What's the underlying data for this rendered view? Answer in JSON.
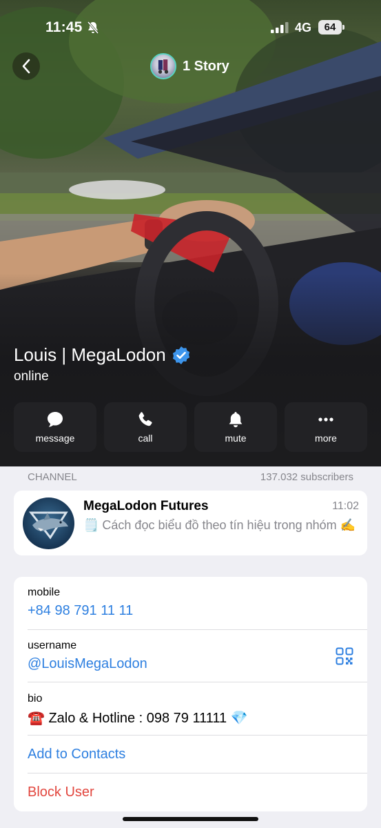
{
  "status_bar": {
    "time": "11:45",
    "network": "4G",
    "battery": "64"
  },
  "nav": {
    "story_label": "1 Story"
  },
  "profile": {
    "name": "Louis | MegaLodon",
    "status": "online"
  },
  "actions": [
    {
      "label": "message",
      "icon": "message-icon"
    },
    {
      "label": "call",
      "icon": "phone-icon"
    },
    {
      "label": "mute",
      "icon": "bell-icon"
    },
    {
      "label": "more",
      "icon": "ellipsis-icon"
    }
  ],
  "channel_section": {
    "heading": "CHANNEL",
    "subscribers": "137.032 subscribers"
  },
  "channel": {
    "title": "MegaLodon Futures",
    "time": "11:02",
    "preview": "🗒️ Cách đọc biểu đồ theo tín hiệu trong nhóm ✍️"
  },
  "info": {
    "mobile_label": "mobile",
    "mobile_value": "+84 98 791 11 11",
    "username_label": "username",
    "username_value": "@LouisMegaLodon",
    "bio_label": "bio",
    "bio_value": "☎️ Zalo & Hotline : 098 79 11111 💎",
    "add_contacts": "Add to Contacts",
    "block_user": "Block User"
  },
  "colors": {
    "accent": "#2d7fe0",
    "danger": "#e2463e",
    "verified": "#3d95ec",
    "background": "#efeff4"
  }
}
